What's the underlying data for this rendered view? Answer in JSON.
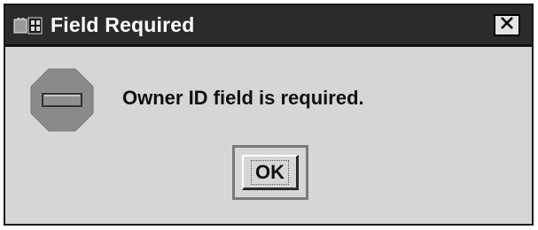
{
  "dialog": {
    "title": "Field Required",
    "message": "Owner ID field is required.",
    "ok_label": "OK",
    "close_glyph": "✕",
    "icons": {
      "app": "coffee-cup-icon",
      "message": "stop-sign-icon",
      "close": "close-icon"
    }
  }
}
